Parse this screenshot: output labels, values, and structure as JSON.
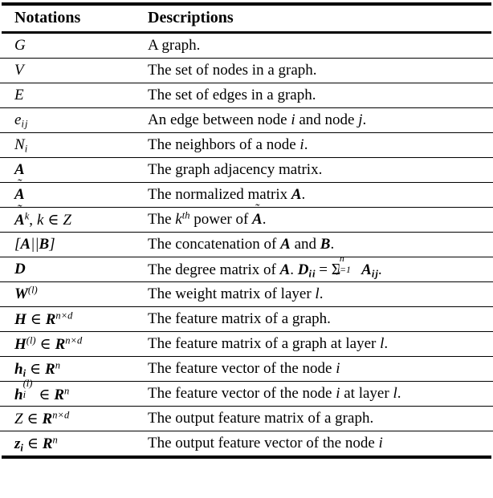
{
  "table": {
    "caption_columns": {
      "notations": "Notations",
      "descriptions": "Descriptions"
    },
    "rows": [
      {
        "notation_text": "G",
        "description_text": "A graph."
      },
      {
        "notation_text": "V",
        "description_text": "The set of nodes in a graph."
      },
      {
        "notation_text": "E",
        "description_text": "The set of edges in a graph."
      },
      {
        "notation_text": "e_ij",
        "description_text": "An edge between node i and node j."
      },
      {
        "notation_text": "N_i",
        "description_text": "The neighbors of a node i."
      },
      {
        "notation_text": "A",
        "description_text": "The graph adjacency matrix."
      },
      {
        "notation_text": "Ã",
        "description_text": "The normalized matrix A."
      },
      {
        "notation_text": "Ã^k, k ∈ Z",
        "description_text": "The k^th power of Ã."
      },
      {
        "notation_text": "[A||B]",
        "description_text": "The concatenation of A and B."
      },
      {
        "notation_text": "D",
        "description_text": "The degree matrix of A. D_ii = Σ_{j=1}^{n} A_ij."
      },
      {
        "notation_text": "W^(l)",
        "description_text": "The weight matrix of layer l."
      },
      {
        "notation_text": "H ∈ R^{n×d}",
        "description_text": "The feature matrix of a graph."
      },
      {
        "notation_text": "H^(l) ∈ R^{n×d}",
        "description_text": "The feature matrix of a graph at layer l."
      },
      {
        "notation_text": "h_i ∈ R^n",
        "description_text": "The feature vector of the node i"
      },
      {
        "notation_text": "h_i^(l) ∈ R^n",
        "description_text": "The feature vector of the node i at layer l."
      },
      {
        "notation_text": "Z ∈ R^{n×d}",
        "description_text": "The output feature matrix of a graph."
      },
      {
        "notation_text": "z_i ∈ R^n",
        "description_text": "The output feature vector of the node i"
      }
    ],
    "symbols": {
      "elementof": "∈",
      "times": "×",
      "sum": "Σ",
      "doublebar": "||",
      "tilde": "~",
      "equals": "="
    }
  }
}
